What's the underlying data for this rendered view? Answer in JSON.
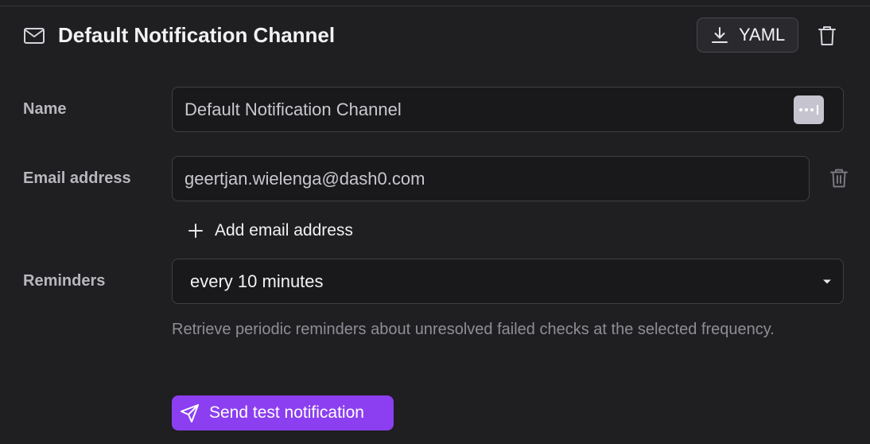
{
  "header": {
    "title": "Default Notification Channel",
    "yaml_label": "YAML",
    "icons": [
      "mail-icon",
      "download-icon",
      "trash-icon"
    ]
  },
  "form": {
    "name": {
      "label": "Name",
      "value": "Default Notification Channel"
    },
    "email": {
      "label": "Email address",
      "value": "geertjan.wielenga@dash0.com",
      "add_label": "Add email address"
    },
    "reminders": {
      "label": "Reminders",
      "selected": "every 10 minutes",
      "help": "Retrieve periodic reminders about unresolved failed checks at the selected frequency."
    }
  },
  "actions": {
    "send_test_label": "Send test notification"
  },
  "colors": {
    "background": "#1f1e21",
    "input_bg": "#19181b",
    "accent": "#8b3ff0",
    "border": "#3f3e44"
  }
}
